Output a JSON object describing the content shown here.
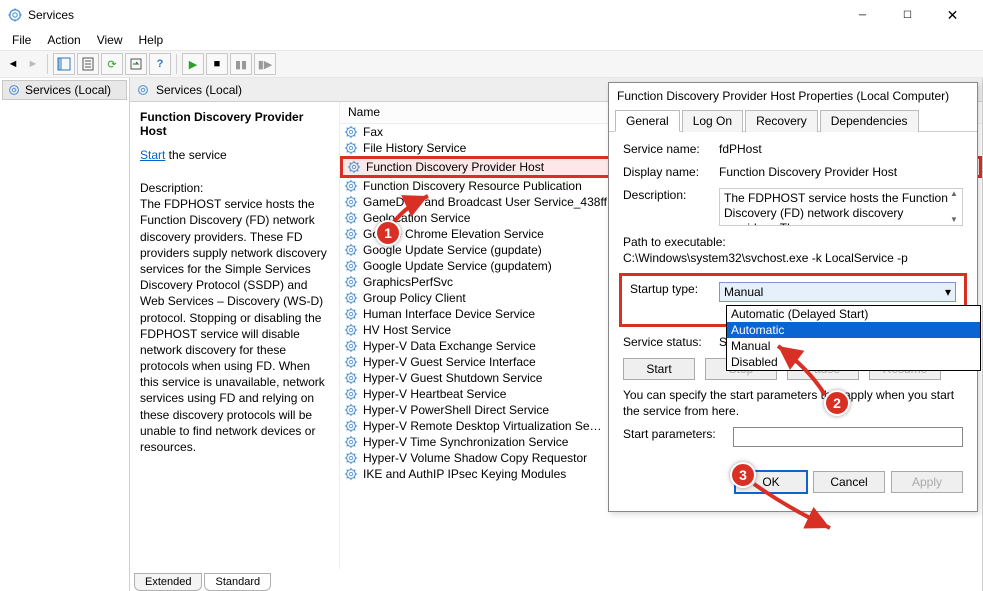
{
  "window": {
    "title": "Services"
  },
  "menus": {
    "file": "File",
    "action": "Action",
    "view": "View",
    "help": "Help"
  },
  "tree": {
    "root": "Services (Local)"
  },
  "middle_header": {
    "label": "Services (Local)"
  },
  "desc": {
    "title": "Function Discovery Provider Host",
    "start_word": "Start",
    "after_start": " the service",
    "heading": "Description:",
    "body": "The FDPHOST service hosts the Function Discovery (FD) network discovery providers. These FD providers supply network discovery services for the Simple Services Discovery Protocol (SSDP) and Web Services – Discovery (WS-D) protocol. Stopping or disabling the FDPHOST service will disable network discovery for these protocols when using FD. When this service is unavailable, network services using FD and relying on these discovery protocols will be unable to find network devices or resources."
  },
  "list_header": "Name",
  "services": [
    "Fax",
    "File History Service",
    "Function Discovery Provider Host",
    "Function Discovery Resource Publication",
    "GameDVR and Broadcast User Service_438ff",
    "Geolocation Service",
    "Google Chrome Elevation Service",
    "Google Update Service (gupdate)",
    "Google Update Service (gupdatem)",
    "GraphicsPerfSvc",
    "Group Policy Client",
    "Human Interface Device Service",
    "HV Host Service",
    "Hyper-V Data Exchange Service",
    "Hyper-V Guest Service Interface",
    "Hyper-V Guest Shutdown Service",
    "Hyper-V Heartbeat Service",
    "Hyper-V PowerShell Direct Service",
    "Hyper-V Remote Desktop Virtualization Se…",
    "Hyper-V Time Synchronization Service",
    "Hyper-V Volume Shadow Copy Requestor",
    "IKE and AuthIP IPsec Keying Modules"
  ],
  "tabs_bottom": {
    "ext": "Extended",
    "std": "Standard"
  },
  "dialog": {
    "title": "Function Discovery Provider Host Properties (Local Computer)",
    "tabs": {
      "general": "General",
      "logon": "Log On",
      "recovery": "Recovery",
      "deps": "Dependencies"
    },
    "lbl_svc_name": "Service name:",
    "val_svc_name": "fdPHost",
    "lbl_disp_name": "Display name:",
    "val_disp_name": "Function Discovery Provider Host",
    "lbl_desc": "Description:",
    "val_desc": "The FDPHOST service hosts the Function Discovery (FD) network discovery providers. These",
    "lbl_path": "Path to executable:",
    "val_path": "C:\\Windows\\system32\\svchost.exe -k LocalService -p",
    "lbl_startup": "Startup type:",
    "val_startup": "Manual",
    "dd_options": [
      "Automatic (Delayed Start)",
      "Automatic",
      "Manual",
      "Disabled"
    ],
    "lbl_status": "Service status:",
    "val_status": "Stopped",
    "btn_start": "Start",
    "btn_stop": "Stop",
    "btn_pause": "Pause",
    "btn_resume": "Resume",
    "hint": "You can specify the start parameters that apply when you start the service from here.",
    "lbl_param": "Start parameters:",
    "btn_ok": "OK",
    "btn_cancel": "Cancel",
    "btn_apply": "Apply"
  },
  "callouts": {
    "one": "1",
    "two": "2",
    "three": "3"
  }
}
